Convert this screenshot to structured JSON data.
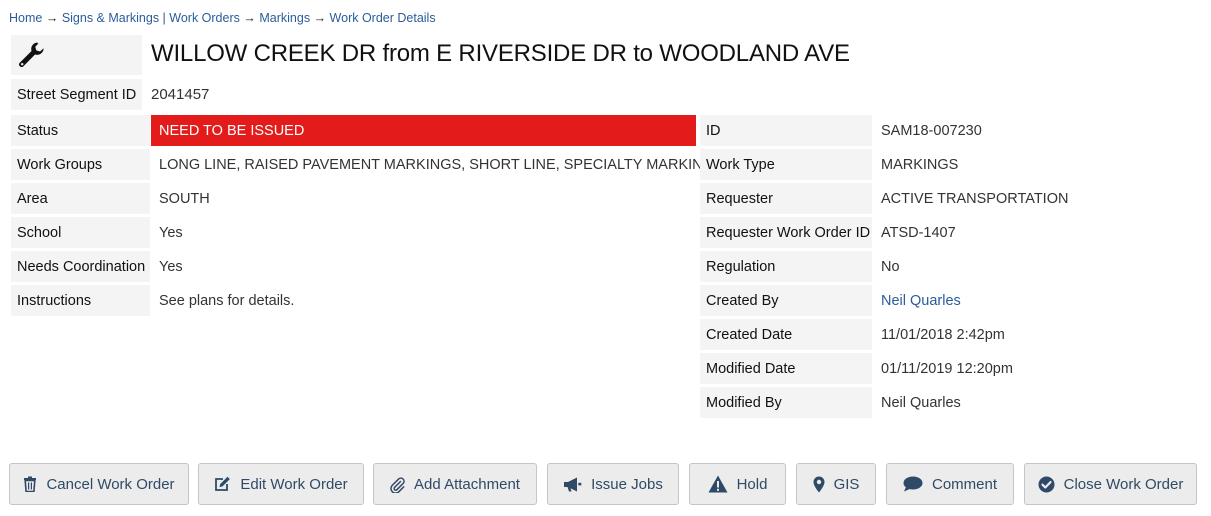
{
  "breadcrumb": {
    "home": "Home",
    "sep1": "→",
    "orders": "Signs & Markings | Work Orders",
    "sep2": "→",
    "markings": "Markings",
    "sep3": "→",
    "details": "Work Order Details"
  },
  "header": {
    "icon": "wrench-icon",
    "title": "WILLOW CREEK DR from E RIVERSIDE DR to WOODLAND AVE"
  },
  "segment": {
    "label": "Street Segment ID",
    "value": "2041457"
  },
  "status_color": "#e31b1b",
  "left_fields": [
    {
      "label": "Status",
      "value": "NEED TO BE ISSUED"
    },
    {
      "label": "Work Groups",
      "value": "LONG LINE, RAISED PAVEMENT MARKINGS, SHORT LINE, SPECIALTY MARKINGS"
    },
    {
      "label": "Area",
      "value": "SOUTH"
    },
    {
      "label": "School",
      "value": "Yes"
    },
    {
      "label": "Needs Coordination",
      "value": "Yes"
    },
    {
      "label": "Instructions",
      "value": "See plans for details."
    }
  ],
  "right_fields": [
    {
      "label": "ID",
      "value": "SAM18-007230"
    },
    {
      "label": "Work Type",
      "value": "MARKINGS"
    },
    {
      "label": "Requester",
      "value": "ACTIVE TRANSPORTATION"
    },
    {
      "label": "Requester Work Order ID",
      "value": "ATSD-1407"
    },
    {
      "label": "Regulation",
      "value": "No"
    },
    {
      "label": "Created By",
      "value": "Neil Quarles"
    },
    {
      "label": "Created Date",
      "value": "11/01/2018 2:42pm"
    },
    {
      "label": "Modified Date",
      "value": "01/11/2019 12:20pm"
    },
    {
      "label": "Modified By",
      "value": "Neil Quarles"
    }
  ],
  "buttons": [
    {
      "label": "Cancel Work Order",
      "icon": "trash-icon"
    },
    {
      "label": "Edit Work Order",
      "icon": "edit-icon"
    },
    {
      "label": "Add Attachment",
      "icon": "paperclip-icon"
    },
    {
      "label": "Issue Jobs",
      "icon": "megaphone-icon"
    },
    {
      "label": "Hold",
      "icon": "warning-icon"
    },
    {
      "label": "GIS",
      "icon": "map-marker-icon"
    },
    {
      "label": "Comment",
      "icon": "comment-icon"
    },
    {
      "label": "Close Work Order",
      "icon": "check-circle-icon"
    }
  ]
}
